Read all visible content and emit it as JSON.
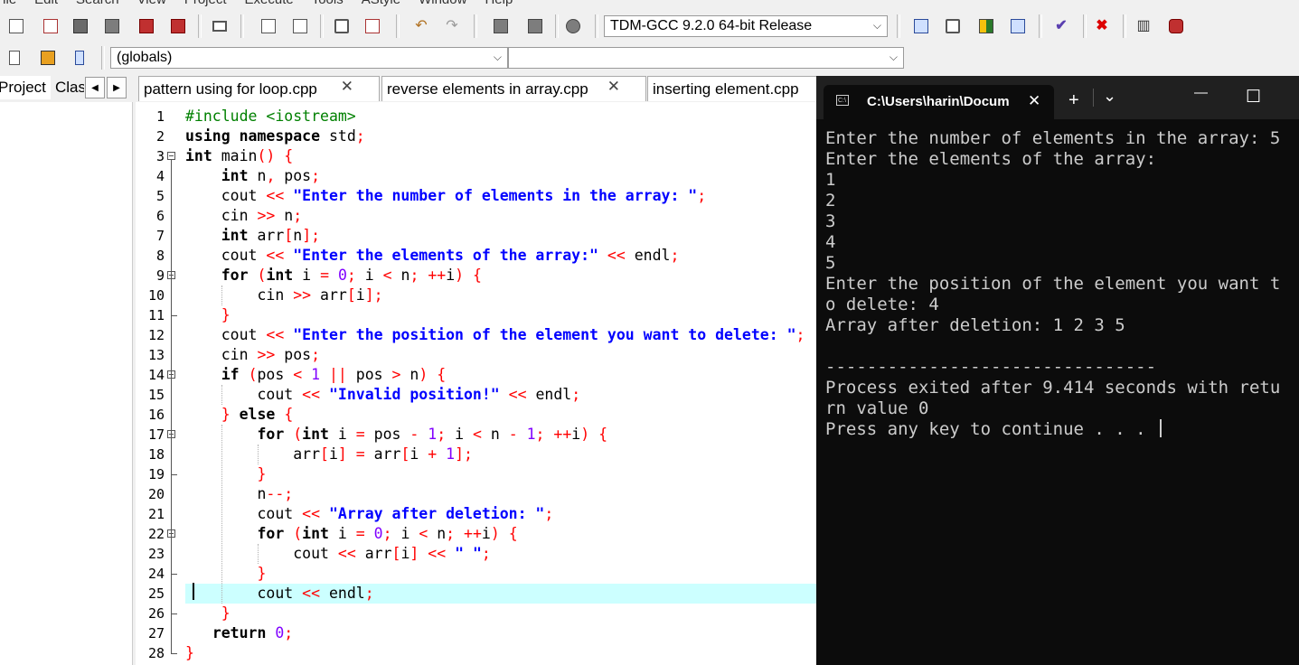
{
  "menu": [
    "File",
    "Edit",
    "Search",
    "View",
    "Project",
    "Execute",
    "Tools",
    "AStyle",
    "Window",
    "Help"
  ],
  "compiler": {
    "selected": "TDM-GCC 9.2.0 64-bit Release"
  },
  "scope": {
    "selected": "(globals)",
    "member": ""
  },
  "left_tabs": {
    "project": "Project",
    "classes": "Clas"
  },
  "file_tabs": [
    {
      "label": "pattern using for loop.cpp",
      "close": "✕"
    },
    {
      "label": "reverse elements in array.cpp",
      "close": "✕"
    },
    {
      "label": "inserting element.cpp"
    }
  ],
  "icons": {
    "toolbar1": [
      "new-file-icon",
      "open-icon",
      "save-icon",
      "save-all-icon",
      "close-file-icon",
      "close-all-icon",
      "print-icon",
      "find-icon",
      "replace-icon",
      "indent-icon",
      "unindent-icon",
      "undo-icon",
      "redo-icon",
      "back-icon",
      "forward-icon",
      "toggle-comment-icon",
      "compile-icon",
      "run-icon",
      "compile-run-icon",
      "rebuild-icon",
      "syntax-check-icon",
      "stop-icon",
      "profile-icon",
      "debug-icon"
    ],
    "toolbar2": [
      "goto-icon",
      "bookmark-icon",
      "insert-icon"
    ]
  },
  "code_lines": [
    {
      "n": "1",
      "h": "<span class=\"pp\">#include &lt;iostream&gt;</span>"
    },
    {
      "n": "2",
      "h": "<span class=\"kw\">using namespace</span> std<span class=\"op\">;</span>"
    },
    {
      "n": "3",
      "h": "<span class=\"kw\">int</span> main<span class=\"op\">()</span> <span class=\"op\">{</span>"
    },
    {
      "n": "4",
      "h": "    <span class=\"kw\">int</span> n<span class=\"op\">,</span> pos<span class=\"op\">;</span>"
    },
    {
      "n": "5",
      "h": "    cout <span class=\"op\">&lt;&lt;</span> <span class=\"str\">\"Enter the number of elements in the array: \"</span><span class=\"op\">;</span>"
    },
    {
      "n": "6",
      "h": "    cin <span class=\"op\">&gt;&gt;</span> n<span class=\"op\">;</span>"
    },
    {
      "n": "7",
      "h": "    <span class=\"kw\">int</span> arr<span class=\"op\">[</span>n<span class=\"op\">];</span>"
    },
    {
      "n": "8",
      "h": "    cout <span class=\"op\">&lt;&lt;</span> <span class=\"str\">\"Enter the elements of the array:\"</span> <span class=\"op\">&lt;&lt;</span> endl<span class=\"op\">;</span>"
    },
    {
      "n": "9",
      "h": "    <span class=\"kw\">for</span> <span class=\"op\">(</span><span class=\"kw\">int</span> i <span class=\"op\">=</span> <span class=\"num\">0</span><span class=\"op\">;</span> i <span class=\"op\">&lt;</span> n<span class=\"op\">;</span> <span class=\"op\">++</span>i<span class=\"op\">)</span> <span class=\"op\">{</span>"
    },
    {
      "n": "10",
      "h": "        cin <span class=\"op\">&gt;&gt;</span> arr<span class=\"op\">[</span>i<span class=\"op\">];</span>"
    },
    {
      "n": "11",
      "h": "    <span class=\"op\">}</span>"
    },
    {
      "n": "12",
      "h": "    cout <span class=\"op\">&lt;&lt;</span> <span class=\"str\">\"Enter the position of the element you want to delete: \"</span><span class=\"op\">;</span>"
    },
    {
      "n": "13",
      "h": "    cin <span class=\"op\">&gt;&gt;</span> pos<span class=\"op\">;</span>"
    },
    {
      "n": "14",
      "h": "    <span class=\"kw\">if</span> <span class=\"op\">(</span>pos <span class=\"op\">&lt;</span> <span class=\"num\">1</span> <span class=\"op\">||</span> pos <span class=\"op\">&gt;</span> n<span class=\"op\">)</span> <span class=\"op\">{</span>"
    },
    {
      "n": "15",
      "h": "        cout <span class=\"op\">&lt;&lt;</span> <span class=\"str\">\"Invalid position!\"</span> <span class=\"op\">&lt;&lt;</span> endl<span class=\"op\">;</span>"
    },
    {
      "n": "16",
      "h": "    <span class=\"op\">}</span> <span class=\"kw\">else</span> <span class=\"op\">{</span>"
    },
    {
      "n": "17",
      "h": "        <span class=\"kw\">for</span> <span class=\"op\">(</span><span class=\"kw\">int</span> i <span class=\"op\">=</span> pos <span class=\"op\">-</span> <span class=\"num\">1</span><span class=\"op\">;</span> i <span class=\"op\">&lt;</span> n <span class=\"op\">-</span> <span class=\"num\">1</span><span class=\"op\">;</span> <span class=\"op\">++</span>i<span class=\"op\">)</span> <span class=\"op\">{</span>"
    },
    {
      "n": "18",
      "h": "            arr<span class=\"op\">[</span>i<span class=\"op\">]</span> <span class=\"op\">=</span> arr<span class=\"op\">[</span>i <span class=\"op\">+</span> <span class=\"num\">1</span><span class=\"op\">];</span>"
    },
    {
      "n": "19",
      "h": "        <span class=\"op\">}</span>"
    },
    {
      "n": "20",
      "h": "        n<span class=\"op\">--;</span>"
    },
    {
      "n": "21",
      "h": "        cout <span class=\"op\">&lt;&lt;</span> <span class=\"str\">\"Array after deletion: \"</span><span class=\"op\">;</span>"
    },
    {
      "n": "22",
      "h": "        <span class=\"kw\">for</span> <span class=\"op\">(</span><span class=\"kw\">int</span> i <span class=\"op\">=</span> <span class=\"num\">0</span><span class=\"op\">;</span> i <span class=\"op\">&lt;</span> n<span class=\"op\">;</span> <span class=\"op\">++</span>i<span class=\"op\">)</span> <span class=\"op\">{</span>"
    },
    {
      "n": "23",
      "h": "            cout <span class=\"op\">&lt;&lt;</span> arr<span class=\"op\">[</span>i<span class=\"op\">]</span> <span class=\"op\">&lt;&lt;</span> <span class=\"str\">\" \"</span><span class=\"op\">;</span>"
    },
    {
      "n": "24",
      "h": "        <span class=\"op\">}</span>"
    },
    {
      "n": "25",
      "h": "        cout <span class=\"op\">&lt;&lt;</span> endl<span class=\"op\">;</span>"
    },
    {
      "n": "26",
      "h": "    <span class=\"op\">}</span>"
    },
    {
      "n": "27",
      "h": "   <span class=\"kw\">return</span> <span class=\"num\">0</span><span class=\"op\">;</span>"
    },
    {
      "n": "28",
      "h": "<span class=\"op\">}</span>"
    }
  ],
  "active_line": "25",
  "colors": {
    "keyword": "#000000",
    "string": "#0000ff",
    "number": "#8000ff",
    "operator": "#ff0000",
    "preprocessor": "#008000",
    "active_line_bg": "#ccffff"
  },
  "console": {
    "tab_title": "C:\\Users\\harin\\Docum",
    "close": "✕",
    "new_tab": "+",
    "dropdown": "⌄",
    "minimize": "—",
    "maximize": "☐",
    "lines": [
      "Enter the number of elements in the array: 5",
      "Enter the elements of the array:",
      "1",
      "2",
      "3",
      "4",
      "5",
      "Enter the position of the element you want t",
      "o delete: 4",
      "Array after deletion: 1 2 3 5",
      "",
      "--------------------------------",
      "Process exited after 9.414 seconds with retu",
      "rn value 0",
      "Press any key to continue . . . "
    ]
  }
}
